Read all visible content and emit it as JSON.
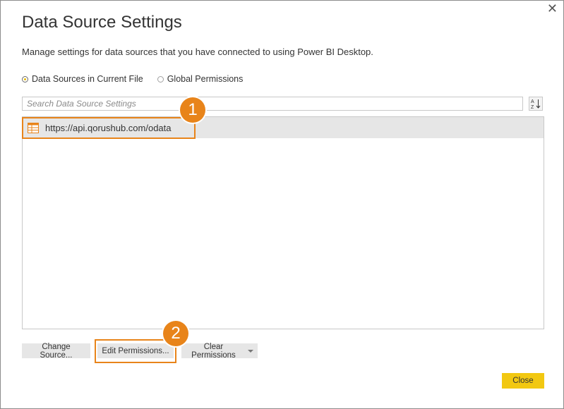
{
  "dialog": {
    "title": "Data Source Settings",
    "subtitle": "Manage settings for data sources that you have connected to using Power BI Desktop.",
    "close_glyph": "✕"
  },
  "scope": {
    "options": [
      {
        "label": "Data Sources in Current File",
        "checked": true
      },
      {
        "label": "Global Permissions",
        "checked": false
      }
    ]
  },
  "search": {
    "placeholder": "Search Data Source Settings",
    "value": ""
  },
  "sort": {
    "icon": "sort-az-icon"
  },
  "sources": [
    {
      "url": "https://api.qorushub.com/odata",
      "icon": "table-icon",
      "selected": true
    }
  ],
  "buttons": {
    "change_source": "Change Source...",
    "edit_permissions": "Edit Permissions...",
    "clear_permissions": "Clear Permissions",
    "close": "Close"
  },
  "callouts": [
    {
      "number": "1"
    },
    {
      "number": "2"
    }
  ],
  "colors": {
    "accent": "#e8841a",
    "close_button": "#f2c811",
    "radio_dot": "#e6b800"
  }
}
